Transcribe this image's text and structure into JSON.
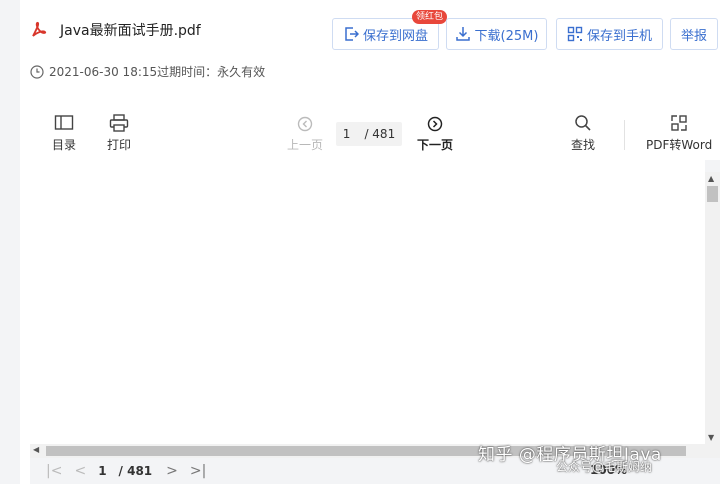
{
  "file": {
    "name": "Java最新面试手册.pdf",
    "meta": "2021-06-30 18:15过期时间：永久有效"
  },
  "header_buttons": {
    "save_disk": "保存到网盘",
    "badge": "领红包",
    "download": "下载(25M)",
    "save_phone": "保存到手机",
    "report": "举报"
  },
  "toolbar": {
    "toc": "目录",
    "print": "打印",
    "prev": "上一页",
    "next": "下一页",
    "search": "查找",
    "word": "PDF转Word",
    "current_page": "1",
    "total_pages": "/ 481"
  },
  "pager": {
    "current_page": "1",
    "total_pages": "/ 481",
    "zoom": "100%"
  },
  "watermark": {
    "line1": "知乎 @程序员斯坦Java",
    "line2": "公众号@毛斯姆纳"
  },
  "colors": {
    "accent": "#3a6fcf",
    "pdf_red": "#d8362b",
    "badge": "#e8473b"
  }
}
